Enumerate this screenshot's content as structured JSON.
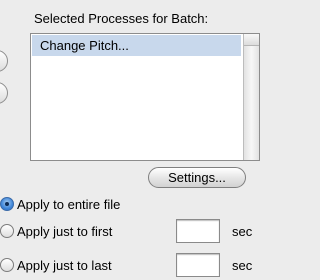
{
  "batch": {
    "heading": "Selected Processes for Batch:",
    "processes": [
      "Change Pitch..."
    ],
    "settings_label": "Settings..."
  },
  "apply": {
    "options": [
      {
        "label": "Apply to entire file",
        "selected": true
      },
      {
        "label": "Apply just to first",
        "selected": false,
        "value": "",
        "unit": "sec"
      },
      {
        "label": "Apply just to last",
        "selected": false,
        "value": "",
        "unit": "sec"
      }
    ]
  }
}
